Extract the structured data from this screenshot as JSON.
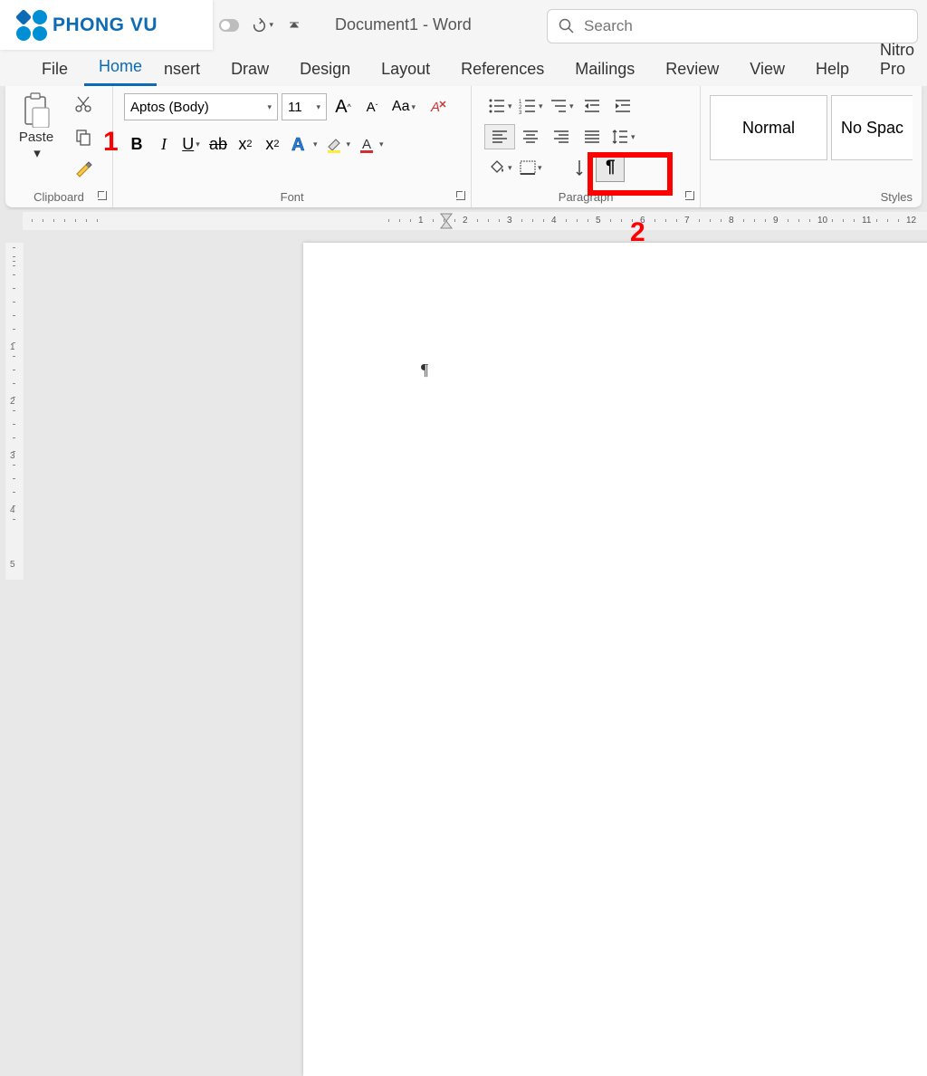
{
  "logo": {
    "text": "PHONG VU"
  },
  "title": "Document1  -  Word",
  "search": {
    "placeholder": "Search"
  },
  "tabs": {
    "file": "File",
    "home": "Home",
    "insert": "nsert",
    "draw": "Draw",
    "design": "Design",
    "layout": "Layout",
    "references": "References",
    "mailings": "Mailings",
    "review": "Review",
    "view": "View",
    "help": "Help",
    "nitro": "Nitro Pro"
  },
  "ribbon": {
    "clipboard": {
      "paste": "Paste",
      "label": "Clipboard"
    },
    "font": {
      "name": "Aptos (Body)",
      "size": "11",
      "case": "Aa",
      "label": "Font"
    },
    "paragraph": {
      "label": "Paragraph",
      "pilcrow": "¶"
    },
    "styles": {
      "normal": "Normal",
      "nospacing": "No Spac",
      "label": "Styles"
    }
  },
  "annotations": {
    "one": "1",
    "two": "2"
  },
  "ruler": {
    "marks": [
      "1",
      "2",
      "3",
      "4",
      "5",
      "6",
      "7",
      "8",
      "9",
      "10",
      "11",
      "12"
    ]
  },
  "vruler": {
    "marks": [
      "1",
      "2",
      "3",
      "4",
      "5"
    ]
  },
  "page": {
    "content_mark": "¶"
  }
}
